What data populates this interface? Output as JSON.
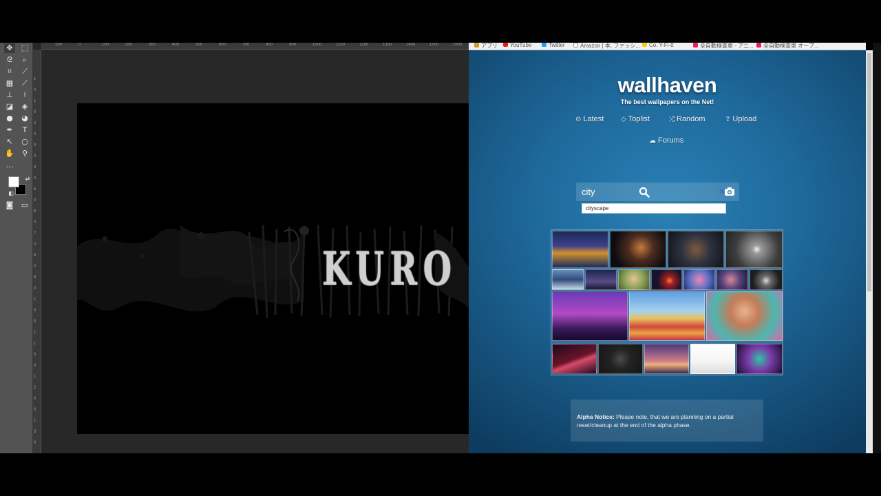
{
  "photoshop": {
    "ruler_h": [
      "100",
      "0",
      "100",
      "200",
      "300",
      "400",
      "500",
      "600",
      "700",
      "800",
      "900",
      "1000",
      "1100",
      "1200",
      "1300",
      "1400",
      "1500",
      "1600"
    ],
    "ruler_v": [
      "1",
      "0",
      "1",
      "0",
      "2",
      "0",
      "3",
      "0",
      "4",
      "0",
      "5",
      "0",
      "6",
      "0",
      "7",
      "0",
      "8",
      "0",
      "9",
      "0",
      "1",
      "0",
      "0",
      "1",
      "1",
      "0",
      "0",
      "1",
      "2",
      "0",
      "0",
      "1",
      "3",
      "0"
    ],
    "canvas_text": "KURO"
  },
  "browser": {
    "bookmarks": [
      {
        "label": "アプリ",
        "color": "#d59b1a"
      },
      {
        "label": "YouTube",
        "color": "#e62117"
      },
      {
        "label": "Twitter",
        "color": "#1da1f2"
      },
      {
        "label": "Amazon | 本, ファッシ...",
        "color": "#ffffff"
      },
      {
        "label": "Co. Y-Fi-tt",
        "color": "#ffcc00"
      },
      {
        "label": "全自動検査車 - アニ...",
        "color": "#e91e63"
      },
      {
        "label": "全自動検査車 オープ...",
        "color": "#e91e63"
      }
    ],
    "site": {
      "logo": "wallhaven",
      "tagline": "The best wallpapers on the Net!",
      "nav": {
        "latest": "Latest",
        "toplist": "Toplist",
        "random": "Random",
        "upload": "Upload",
        "forums": "Forums"
      },
      "search": {
        "value": "city",
        "suggestion": "cityscape"
      },
      "notice": {
        "label": "Alpha Notice:",
        "text": " Please note, that we are planning on a partial reset/cleanup at the end of the alpha phase."
      }
    }
  }
}
